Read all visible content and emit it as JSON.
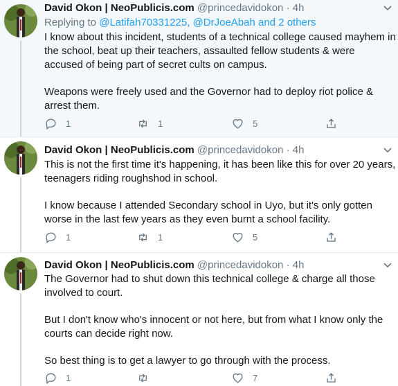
{
  "tweets": [
    {
      "author": "David Okon | NeoPublicis.com",
      "handle": "@princedavidokon",
      "dot": "·",
      "time": "4h",
      "replying_prefix": "Replying to ",
      "replying_links": "@Latifah70331225, @DrJoeAbah and 2 others",
      "paragraphs": [
        "I know about this incident, students of a technical college caused mayhem in the school, beat up their teachers, assaulted fellow students & were accused of being part of secret cults on campus.",
        "Weapons were freely used and the Governor had to deploy riot police & arrest them."
      ],
      "replies": "1",
      "retweets": "1",
      "likes": "5"
    },
    {
      "author": "David Okon | NeoPublicis.com",
      "handle": "@princedavidokon",
      "dot": "·",
      "time": "4h",
      "paragraphs": [
        "This is not the first time it's happening, it has been like this for over 20 years, teenagers riding roughshod in school.",
        "I know because I attended Secondary school in Uyo, but it's only gotten worse in the last few years as they even burnt a school facility."
      ],
      "replies": "1",
      "retweets": "1",
      "likes": "5"
    },
    {
      "author": "David Okon | NeoPublicis.com",
      "handle": "@princedavidokon",
      "dot": "·",
      "time": "4h",
      "paragraphs": [
        "The Governor had to shut down this technical college & charge all those involved to court.",
        "But I don't know who's innocent or not here, but from what I know only the courts can decide right now.",
        "So best thing is to get a lawyer to go through with the process."
      ],
      "replies": "1",
      "retweets": "",
      "likes": "7"
    }
  ],
  "icons": [
    "avatar-photo",
    "chevron-down-icon",
    "reply-icon",
    "retweet-icon",
    "like-icon",
    "share-icon"
  ],
  "colors": {
    "link": "#1da1f2",
    "secondary": "#657786",
    "highlight_bg": "#f5f8fa",
    "divider": "#e6ecf0"
  }
}
